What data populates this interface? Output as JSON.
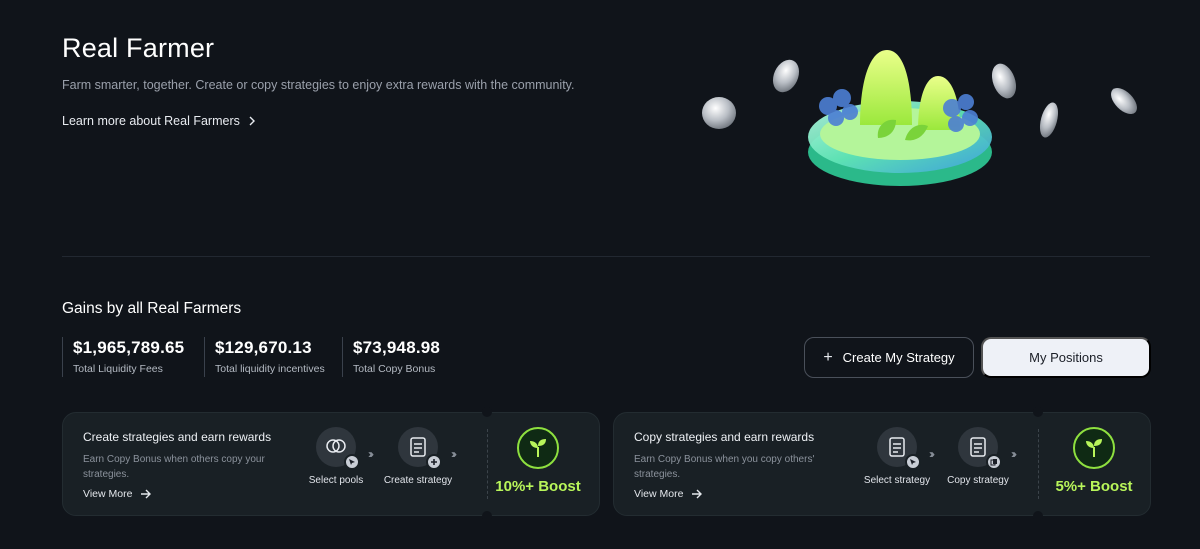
{
  "hero": {
    "title": "Real Farmer",
    "subtitle": "Farm smarter, together. Create or copy strategies to enjoy extra rewards with the community.",
    "learn_more": "Learn more about Real Farmers"
  },
  "gains": {
    "title": "Gains by all Real Farmers",
    "stats": [
      {
        "value": "$1,965,789.65",
        "label": "Total Liquidity Fees"
      },
      {
        "value": "$129,670.13",
        "label": "Total liquidity incentives"
      },
      {
        "value": "$73,948.98",
        "label": "Total Copy Bonus"
      }
    ]
  },
  "actions": {
    "create_label": "Create My Strategy",
    "positions_label": "My Positions"
  },
  "cards": [
    {
      "title": "Create strategies and earn rewards",
      "description": "Earn Copy Bonus when others copy your strategies.",
      "view_more": "View More",
      "steps": [
        "Select pools",
        "Create strategy"
      ],
      "boost": "10%+ Boost"
    },
    {
      "title": "Copy strategies and earn rewards",
      "description": "Earn Copy Bonus when you copy others' strategies.",
      "view_more": "View More",
      "steps": [
        "Select strategy",
        "Copy strategy"
      ],
      "boost": "5%+ Boost"
    }
  ],
  "icons": {
    "learn_more": "chevron-right-icon",
    "create": "plus-icon",
    "view_more": "arrow-right-icon",
    "boost": "sprout-icon"
  },
  "colors": {
    "background": "#10141a",
    "card": "#192025",
    "accent_green": "#b8f55a",
    "button_light": "#eef1f7"
  }
}
